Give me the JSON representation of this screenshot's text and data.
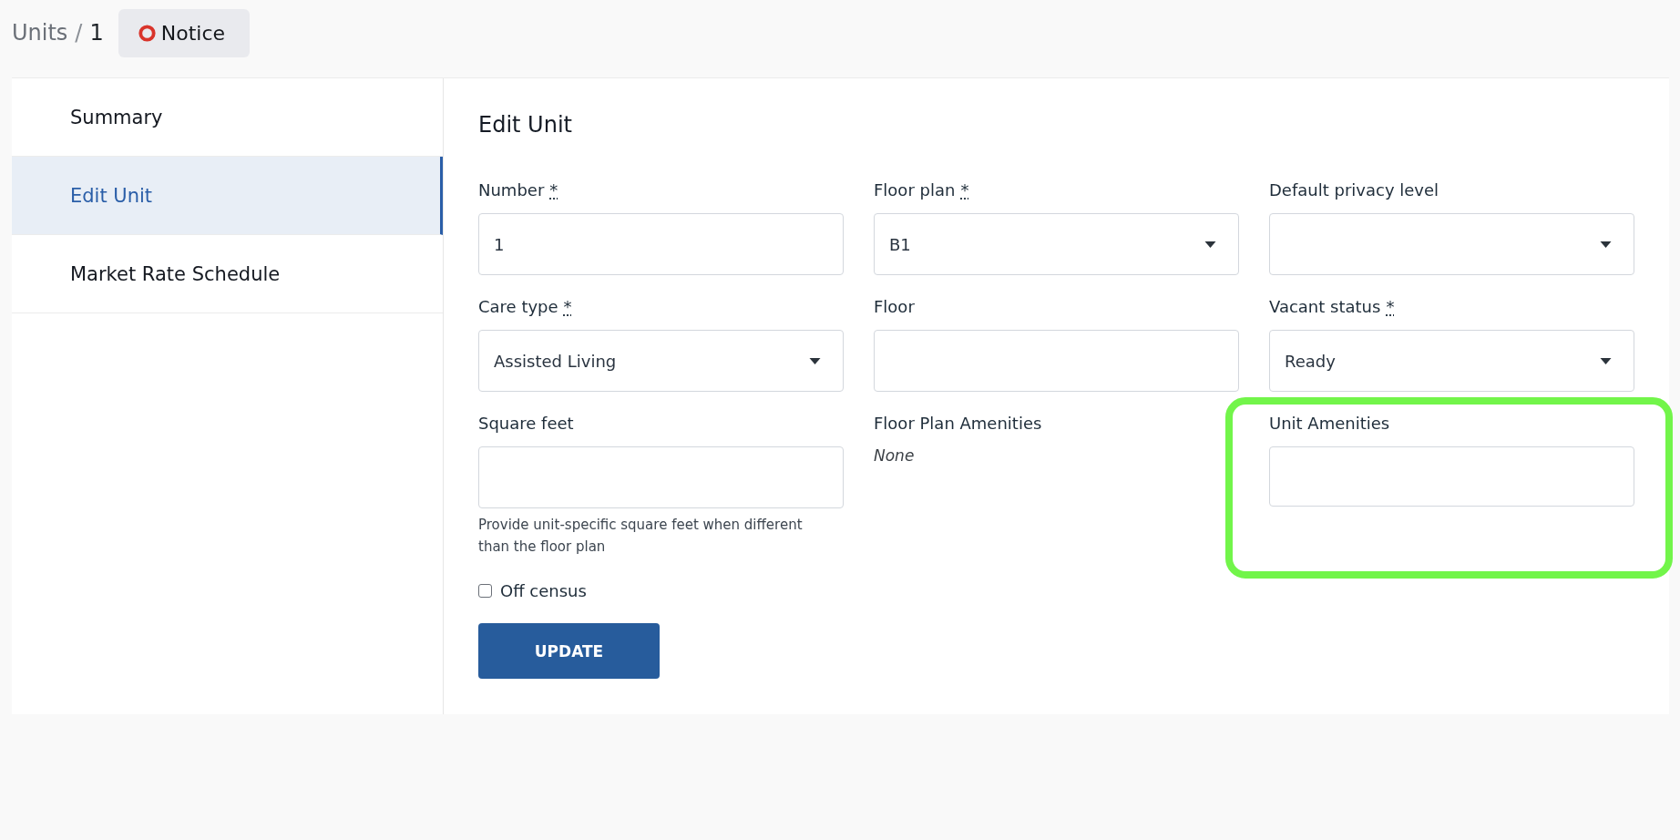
{
  "breadcrumb": {
    "parent": "Units",
    "separator": "/",
    "current": "1"
  },
  "status_badge": {
    "label": "Notice"
  },
  "sidebar": {
    "items": [
      {
        "label": "Summary",
        "selected": false
      },
      {
        "label": "Edit Unit",
        "selected": true
      },
      {
        "label": "Market Rate Schedule",
        "selected": false
      }
    ]
  },
  "form": {
    "heading": "Edit Unit",
    "fields": [
      {
        "kind": "text",
        "label": "Number",
        "required_mark": "*",
        "value": "1",
        "highlighted": false
      },
      {
        "kind": "select",
        "label": "Floor plan",
        "required_mark": "*",
        "value": "B1",
        "highlighted": false
      },
      {
        "kind": "select",
        "label": "Default privacy level",
        "highlighted": false
      },
      {
        "kind": "select",
        "label": "Care type",
        "required_mark": "*",
        "value": "Assisted Living",
        "highlighted": false
      },
      {
        "kind": "text",
        "label": "Floor",
        "highlighted": false
      },
      {
        "kind": "select",
        "label": "Vacant status",
        "required_mark": "*",
        "value": "Ready",
        "highlighted": false
      },
      {
        "kind": "text",
        "label": "Square feet",
        "help": "Provide unit-specific square feet when different than the floor plan",
        "highlighted": false
      },
      {
        "kind": "static",
        "label": "Floor Plan Amenities",
        "value": "None",
        "highlighted": false
      },
      {
        "kind": "text",
        "label": "Unit Amenities",
        "highlighted": true
      }
    ],
    "checkbox": {
      "label": "Off census",
      "checked": false
    },
    "submit_button": "UPDATE"
  }
}
